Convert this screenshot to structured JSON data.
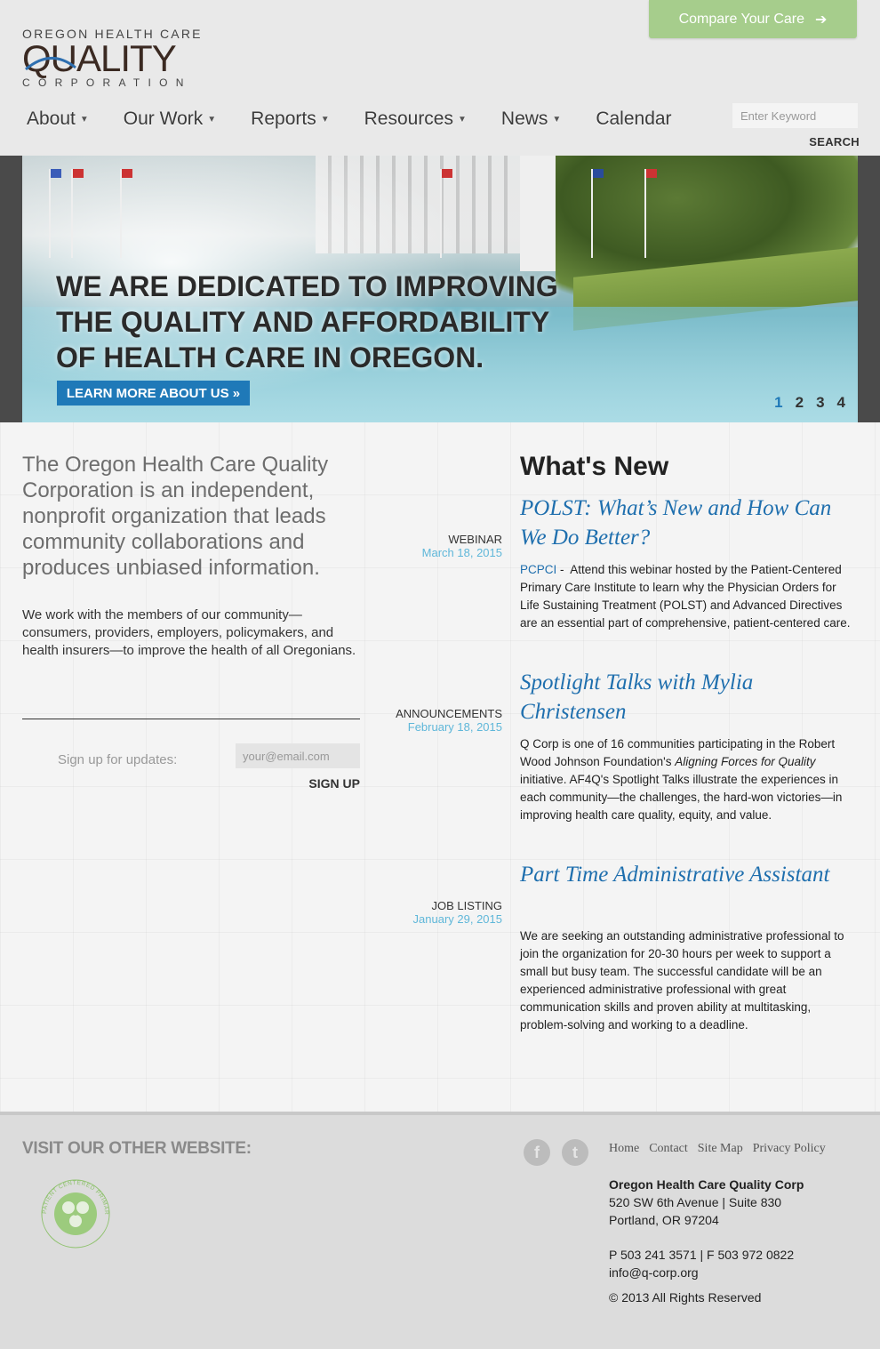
{
  "header": {
    "logo_top": "OREGON HEALTH CARE",
    "logo_mid": "QUALITY",
    "logo_bot": "CORPORATION",
    "compare_button": "Compare Your Care",
    "nav": [
      {
        "label": "About",
        "dropdown": true
      },
      {
        "label": "Our Work",
        "dropdown": true
      },
      {
        "label": "Reports",
        "dropdown": true
      },
      {
        "label": "Resources",
        "dropdown": true
      },
      {
        "label": "News",
        "dropdown": true
      },
      {
        "label": "Calendar",
        "dropdown": false
      }
    ],
    "search_placeholder": "Enter Keyword",
    "search_button": "SEARCH"
  },
  "hero": {
    "lines": [
      "WE ARE DEDICATED TO IMPROVING",
      "THE QUALITY AND AFFORDABILITY",
      "OF HEALTH CARE IN OREGON."
    ],
    "button": "LEARN MORE ABOUT US »",
    "slides": [
      "1",
      "2",
      "3",
      "4"
    ],
    "active_slide": "1"
  },
  "intro": {
    "lead": "The Oregon Health Care Quality Corporation is an independent, nonprofit organization that leads community collaborations and produces unbiased information.",
    "body": "We work with the members of our community—consumers, providers, employers, policymakers, and health insurers—to improve the health of all Oregonians."
  },
  "signup": {
    "label": "Sign up for updates:",
    "placeholder": "your@email.com",
    "button": "SIGN UP"
  },
  "whats_new": {
    "heading": "What's New",
    "items": [
      {
        "type": "WEBINAR",
        "date": "March 18, 2015",
        "title": "POLST: What’s New and How Can We Do Better?",
        "tag": "PCPCI",
        "body": "Attend this webinar hosted by the Patient-Centered Primary Care Institute to learn why the Physician Orders for Life Sustaining Treatment (POLST) and Advanced Directives are an essential part of comprehensive, patient-centered care."
      },
      {
        "type": "ANNOUNCEMENTS",
        "date": "February 18, 2015",
        "title": "Spotlight Talks with Mylia Christensen",
        "body_pre": "Q Corp is one of 16 communities participating in the Robert Wood Johnson Foundation's ",
        "body_em": "Aligning Forces for Quality",
        "body_post": " initiative. AF4Q's Spotlight Talks illustrate the experiences in each community—the challenges, the hard-won victories—in improving health care quality, equity, and value."
      },
      {
        "type": "JOB LISTING",
        "date": "January 29, 2015",
        "title": "Part Time Administrative Assistant",
        "body": "We are seeking an outstanding administrative professional to join the organization for 20-30 hours per week to support a small but busy team. The successful candidate will be an experienced administrative professional with great communication skills and proven ability at multitasking, problem-solving and working to a deadline."
      }
    ]
  },
  "footer": {
    "visit": "VISIT OUR OTHER WEBSITE:",
    "pcpci_ring_text": "PATIENT CENTERED PRIMARY CARE INSTITUTE",
    "links": [
      "Home",
      "Contact",
      "Site Map",
      "Privacy Policy"
    ],
    "org": "Oregon Health Care Quality Corp",
    "address1": "520 SW 6th Avenue | Suite 830",
    "address2": "Portland, OR 97204",
    "phone": "P 503 241 3571 | F 503 972 0822",
    "email": "info@q-corp.org",
    "copyright": "© 2013 All Rights Reserved"
  },
  "colors": {
    "accent_blue": "#1f79b8",
    "compare_green": "#a6cd8c",
    "date_blue": "#5fb7d9"
  }
}
